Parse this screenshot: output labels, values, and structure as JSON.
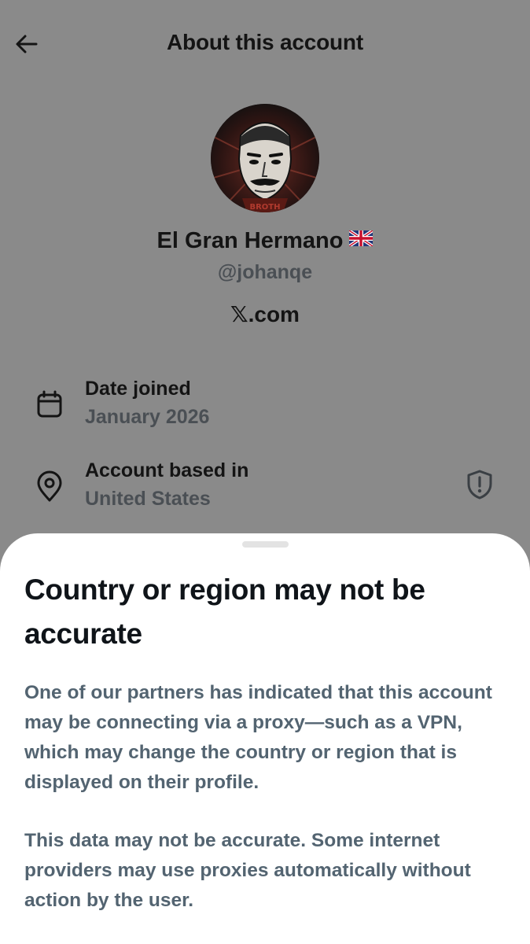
{
  "header": {
    "title": "About this account",
    "back_icon": "arrow-left-icon"
  },
  "profile": {
    "name": "El Gran Hermano",
    "flag_icon": "uk-flag-icon",
    "handle": "@johanqe",
    "site_x": "𝕏",
    "site_rest": ".com"
  },
  "info": {
    "date_joined_label": "Date joined",
    "date_joined_value": "January 2026",
    "based_in_label": "Account based in",
    "based_in_value": "United States"
  },
  "sheet": {
    "title": "Country or region may not be accurate",
    "paragraph1": "One of our partners has indicated that this account may be connecting via a proxy—such as a VPN, which may change the country or region that is displayed on their profile.",
    "paragraph2": "This data may not be accurate. Some internet providers may use proxies automatically without action by the user."
  },
  "colors": {
    "overlay_bg": "#8a8a8a",
    "primary_text": "#0f1419",
    "secondary_text": "#536471",
    "sheet_bg": "#ffffff"
  }
}
